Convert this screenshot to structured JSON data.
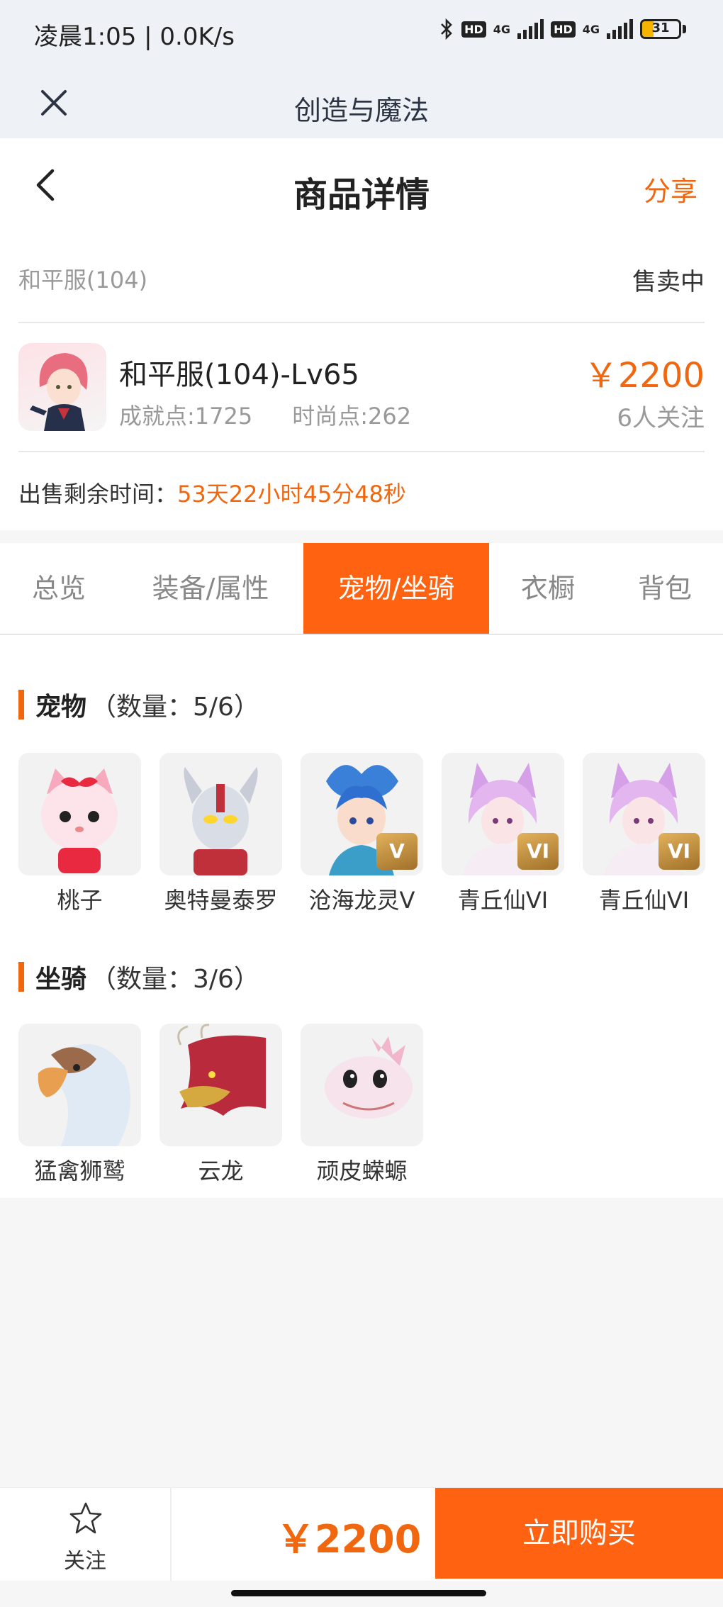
{
  "status_bar": {
    "time_speed": "凌晨1:05 | 0.0K/s",
    "net1": "4G",
    "net2": "4G",
    "hd": "HD",
    "battery": "31",
    "battery_level": 0.31
  },
  "app": {
    "title": "创造与魔法"
  },
  "header": {
    "title": "商品详情",
    "share": "分享"
  },
  "product": {
    "server": "和平服(104)",
    "status": "售卖中",
    "name": "和平服(104)-Lv65",
    "achievement": "成就点:1725",
    "fashion": "时尚点:262",
    "price": "￥2200",
    "watchers": "6人关注",
    "remaining_label": "出售剩余时间：",
    "remaining_value": "53天22小时45分48秒"
  },
  "tabs": [
    {
      "label": "总览"
    },
    {
      "label": "装备/属性"
    },
    {
      "label": "宠物/坐骑"
    },
    {
      "label": "衣橱"
    },
    {
      "label": "背包"
    }
  ],
  "pets": {
    "title": "宠物",
    "count": "（数量：5/6）",
    "items": [
      {
        "name": "桃子"
      },
      {
        "name": "奥特曼泰罗"
      },
      {
        "name": "沧海龙灵V",
        "badge": "V"
      },
      {
        "name": "青丘仙VI",
        "badge": "VI"
      },
      {
        "name": "青丘仙VI",
        "badge": "VI"
      }
    ]
  },
  "mounts": {
    "title": "坐骑",
    "count": "（数量：3/6）",
    "items": [
      {
        "name": "猛禽狮鹫"
      },
      {
        "name": "云龙"
      },
      {
        "name": "顽皮蝾螈"
      }
    ]
  },
  "bottom_bar": {
    "follow": "关注",
    "price": "￥2200",
    "buy": "立即购买"
  },
  "colors": {
    "accent": "#ff6210",
    "price": "#f0670f"
  }
}
